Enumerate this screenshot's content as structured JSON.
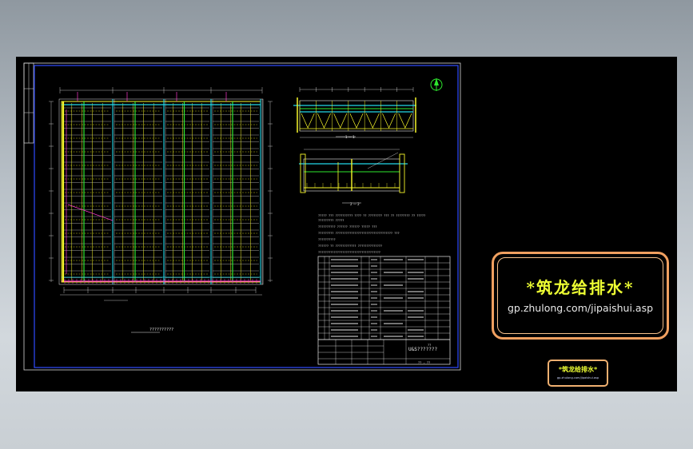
{
  "colors": {
    "background_panel": "#000000",
    "frame": "#2f4bff",
    "yellow": "#f7f72a",
    "cyan": "#22d8e8",
    "green": "#2ee82e",
    "magenta": "#ff3ad0",
    "white": "#e8e8e8",
    "watermark_border": "#f0a060",
    "watermark_text": "#eeff33"
  },
  "drawing": {
    "plan_caption": "??????????",
    "section_labels": [
      "1 — 1",
      "2 — 2"
    ],
    "north_symbol": "①",
    "notes": [
      "????? ??? ?????????? ???? ?? ???????? ??? ?? ???????? ?? ?????",
      "  ????????? ?????",
      "??????????   ??????  ??????  ????? ???",
      "????????? ????????????????????????????????? ???",
      "??????????",
      "?????? ?? ???????????? ??????????????",
      "????????????????????????????????????"
    ],
    "title_block": {
      "title": "U&S???????",
      "drawing_number": "?? — ??",
      "row_numbers": [
        "13",
        "12",
        "11",
        "10",
        "9",
        "8",
        "7",
        "6",
        "5",
        "4",
        "3",
        "2",
        "1"
      ],
      "footer_label": "??"
    }
  },
  "watermark": {
    "title": "*筑龙给排水*",
    "url": "gp.zhulong.com/jipaishui.asp",
    "small_title": "*筑龙给排水*",
    "small_url": "gp.zhulong.com/jipaishui.asp"
  }
}
